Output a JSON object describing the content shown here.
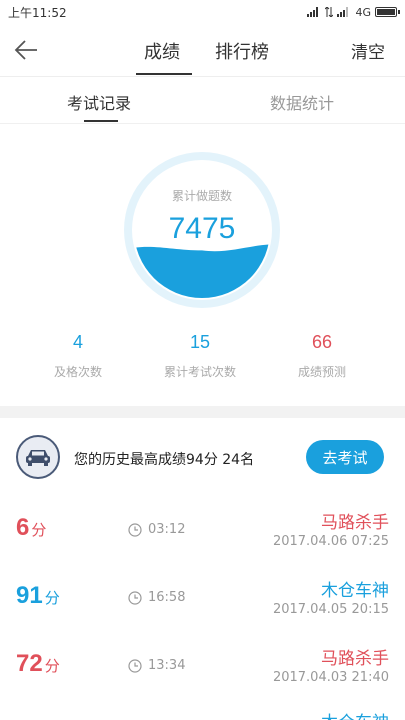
{
  "status_bar": {
    "time": "上午11:52",
    "network": "4G"
  },
  "nav": {
    "tab_score": "成绩",
    "tab_rank": "排行榜",
    "clear": "清空"
  },
  "sub_tabs": {
    "records": "考试记录",
    "stats": "数据统计"
  },
  "gauge": {
    "label": "累计做题数",
    "value": "7475",
    "fill_level": 0.35
  },
  "stats": [
    {
      "value": "4",
      "label": "及格次数",
      "color": "#1aa0dd"
    },
    {
      "value": "15",
      "label": "累计考试次数",
      "color": "#1aa0dd"
    },
    {
      "value": "66",
      "label": "成绩预测",
      "color": "#e0505a"
    }
  ],
  "best": {
    "text": "您的历史最高成绩94分  24名",
    "button": "去考试"
  },
  "records": [
    {
      "score": "6",
      "unit": "分",
      "time": "03:12",
      "title": "马路杀手",
      "date": "2017.04.06  07:25",
      "color": "red"
    },
    {
      "score": "91",
      "unit": "分",
      "time": "16:58",
      "title": "木仓车神",
      "date": "2017.04.05  20:15",
      "color": "blue"
    },
    {
      "score": "72",
      "unit": "分",
      "time": "13:34",
      "title": "马路杀手",
      "date": "2017.04.03  21:40",
      "color": "red"
    },
    {
      "score": "",
      "unit": "",
      "time": "",
      "title": "木仓车神",
      "date": "",
      "color": "blue"
    }
  ],
  "colors": {
    "accent": "#1aa0dd",
    "fail": "#e0505a"
  }
}
